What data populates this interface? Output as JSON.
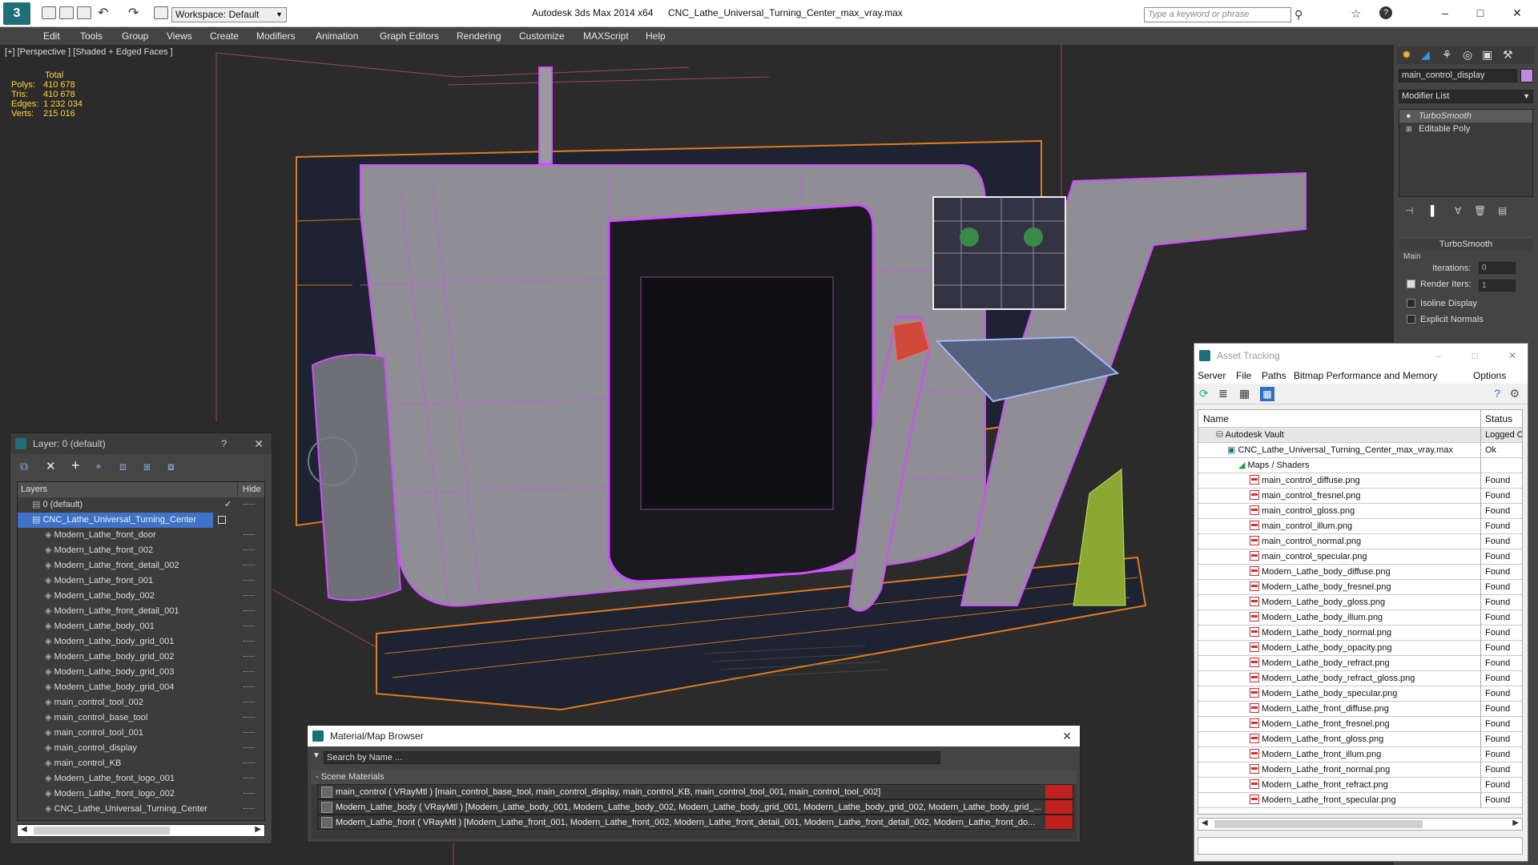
{
  "titlebar": {
    "workspace": "Workspace: Default",
    "app_title": "Autodesk 3ds Max  2014 x64",
    "file_title": "CNC_Lathe_Universal_Turning_Center_max_vray.max",
    "search_placeholder": "Type a keyword or phrase"
  },
  "menu": [
    "Edit",
    "Tools",
    "Group",
    "Views",
    "Create",
    "Modifiers",
    "Animation",
    "Graph Editors",
    "Rendering",
    "Customize",
    "MAXScript",
    "Help"
  ],
  "viewport": {
    "label": "[+] [Perspective ] [Shaded + Edged Faces ]",
    "stats": {
      "header": "Total",
      "rows": [
        {
          "label": "Polys:",
          "value": "410 678"
        },
        {
          "label": "Tris:",
          "value": "410 678"
        },
        {
          "label": "Edges:",
          "value": "1 232 034"
        },
        {
          "label": "Verts:",
          "value": "215 016"
        }
      ]
    }
  },
  "command_panel": {
    "object_name": "main_control_display",
    "modifier_list": "Modifier List",
    "stack": [
      "TurboSmooth",
      "Editable Poly"
    ],
    "rollout_title": "TurboSmooth",
    "main_label": "Main",
    "iterations_label": "Iterations:",
    "iterations_value": "0",
    "render_iters_label": "Render Iters:",
    "render_iters_value": "1",
    "isoline_label": "Isoline Display",
    "explicit_label": "Explicit Normals"
  },
  "layer_panel": {
    "title": "Layer: 0 (default)",
    "help": "?",
    "col_layers": "Layers",
    "col_hide": "Hide",
    "items": [
      "0 (default)",
      "CNC_Lathe_Universal_Turning_Center",
      "Modern_Lathe_front_door",
      "Modern_Lathe_front_002",
      "Modern_Lathe_front_detail_002",
      "Modern_Lathe_front_001",
      "Modern_Lathe_body_002",
      "Modern_Lathe_front_detail_001",
      "Modern_Lathe_body_001",
      "Modern_Lathe_body_grid_001",
      "Modern_Lathe_body_grid_002",
      "Modern_Lathe_body_grid_003",
      "Modern_Lathe_body_grid_004",
      "main_control_tool_002",
      "main_control_base_tool",
      "main_control_tool_001",
      "main_control_display",
      "main_control_KB",
      "Modern_Lathe_front_logo_001",
      "Modern_Lathe_front_logo_002",
      "CNC_Lathe_Universal_Turning_Center"
    ]
  },
  "material_browser": {
    "title": "Material/Map Browser",
    "search_placeholder": "Search by Name ...",
    "section": "- Scene Materials",
    "rows": [
      "main_control ( VRayMtl ) [main_control_base_tool, main_control_display, main_control_KB, main_control_tool_001, main_control_tool_002]",
      "Modern_Lathe_body ( VRayMtl ) [Modern_Lathe_body_001, Modern_Lathe_body_002, Modern_Lathe_body_grid_001, Modern_Lathe_body_grid_002, Modern_Lathe_body_grid_...",
      "Modern_Lathe_front ( VRayMtl ) [Modern_Lathe_front_001, Modern_Lathe_front_002, Modern_Lathe_front_detail_001, Modern_Lathe_front_detail_002, Modern_Lathe_front_do..."
    ]
  },
  "asset_tracking": {
    "title": "Asset Tracking",
    "menu": [
      "Server",
      "File",
      "Paths",
      "Bitmap Performance and Memory",
      "Options"
    ],
    "col_name": "Name",
    "col_status": "Status",
    "vault": {
      "name": "Autodesk Vault",
      "status": "Logged Ou"
    },
    "file": {
      "name": "CNC_Lathe_Universal_Turning_Center_max_vray.max",
      "status": "Ok"
    },
    "folder": "Maps / Shaders",
    "maps": [
      "main_control_diffuse.png",
      "main_control_fresnel.png",
      "main_control_gloss.png",
      "main_control_illum.png",
      "main_control_normal.png",
      "main_control_specular.png",
      "Modern_Lathe_body_diffuse.png",
      "Modern_Lathe_body_fresnel.png",
      "Modern_Lathe_body_gloss.png",
      "Modern_Lathe_body_illum.png",
      "Modern_Lathe_body_normal.png",
      "Modern_Lathe_body_opacity.png",
      "Modern_Lathe_body_refract.png",
      "Modern_Lathe_body_refract_gloss.png",
      "Modern_Lathe_body_specular.png",
      "Modern_Lathe_front_diffuse.png",
      "Modern_Lathe_front_fresnel.png",
      "Modern_Lathe_front_gloss.png",
      "Modern_Lathe_front_illum.png",
      "Modern_Lathe_front_normal.png",
      "Modern_Lathe_front_refract.png",
      "Modern_Lathe_front_specular.png"
    ],
    "found_label": "Found"
  },
  "colors": {
    "selection": "#3f73c9",
    "wire": "#d24dff",
    "orange": "#e07a1c",
    "accent_red": "#c0201e"
  }
}
